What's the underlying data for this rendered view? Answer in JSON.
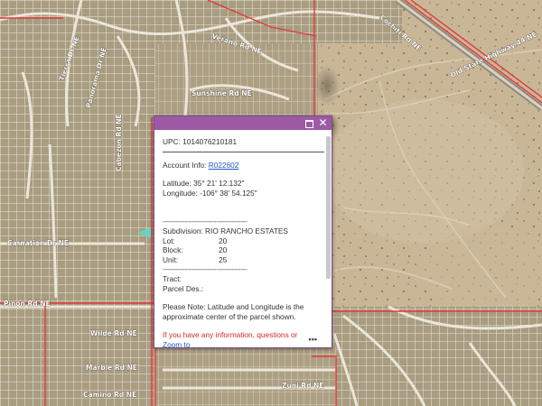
{
  "map": {
    "street_labels": [
      "Old State Highway 44 NE",
      "Sunshine Rd NE",
      "Wilde Rd NE",
      "Marble Rd NE",
      "Camino Rd NE",
      "Zuni Rd NE",
      "Cochiti Rd NE",
      "Verano Rd NE",
      "Cabezon Rd NE",
      "Panorama Dr NE",
      "Tierra Dr NE",
      "Carnation Dr NE",
      "Pinon Rd NE"
    ],
    "colors": {
      "parcel_boundary": "#e03a3a",
      "road": "#e7e1d4",
      "desert": "#c8b596",
      "urban": "#9f9379"
    }
  },
  "popup": {
    "upc": "UPC: 1014076210181",
    "account_label": "Account Info: ",
    "account_link": "R022602",
    "latitude": "Latitude: 35° 21' 12.132\"",
    "longitude": "Longitude: -106° 38' 54.125\"",
    "subdivision": "Subdivision: RIO RANCHO ESTATES",
    "lot_label": "Lot:",
    "lot_value": "20",
    "block_label": "Block:",
    "block_value": "20",
    "unit_label": "Unit:",
    "unit_value": "25",
    "dashes": "--------------------------------------",
    "tract": "Tract:",
    "parcel_des": "Parcel Des.:",
    "note": "Please Note: Latitude and Longitude is the approximate center of the parcel shown.",
    "info_request": "If you have any information, questions or",
    "zoom_link": "Zoom to",
    "more": "•••",
    "close_glyph": "✕",
    "colors": {
      "header": "#9c5aa5",
      "link": "#1f55c9",
      "note": "#d42a2a"
    }
  }
}
